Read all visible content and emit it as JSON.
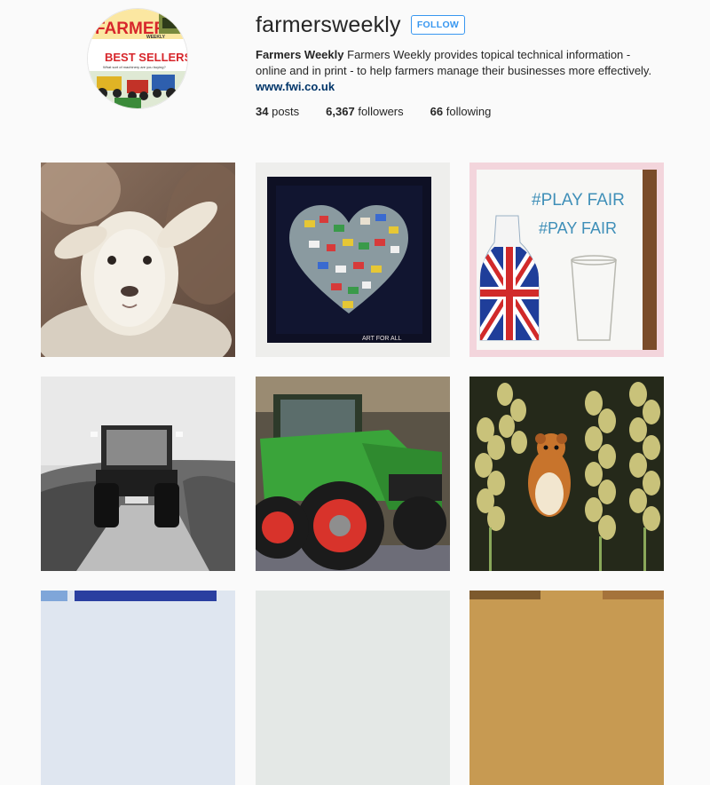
{
  "profile": {
    "username": "farmersweekly",
    "follow_label": "FOLLOW",
    "full_name": "Farmers Weekly",
    "bio": "Farmers Weekly provides topical technical information - online and in print - to help farmers manage their businesses more effectively.",
    "website": "www.fwi.co.uk",
    "avatar": {
      "title": "FARMERS",
      "weekly": "WEEKLY",
      "banner": "BEST SELLERS",
      "tagline": "What sort of machinery are you buying?"
    }
  },
  "stats": {
    "posts_count": "34",
    "posts_label": "posts",
    "followers_count": "6,367",
    "followers_label": "followers",
    "following_count": "66",
    "following_label": "following"
  },
  "posts": [
    {
      "subject": "lamb"
    },
    {
      "subject": "heart-of-tins",
      "caption": "ART FOR ALL"
    },
    {
      "subject": "play-fair-milk",
      "line1": "#PLAY FAIR",
      "line2": "#PAY FAIR"
    },
    {
      "subject": "tractor-road"
    },
    {
      "subject": "green-tractor"
    },
    {
      "subject": "harvest-mouse-wheat"
    },
    {
      "subject": "blue-poster"
    },
    {
      "subject": "pale-photo"
    },
    {
      "subject": "autumn-photo"
    }
  ],
  "colors": {
    "accent": "#3897f0",
    "link": "#003569",
    "background": "#fafafa",
    "text": "#262626"
  }
}
